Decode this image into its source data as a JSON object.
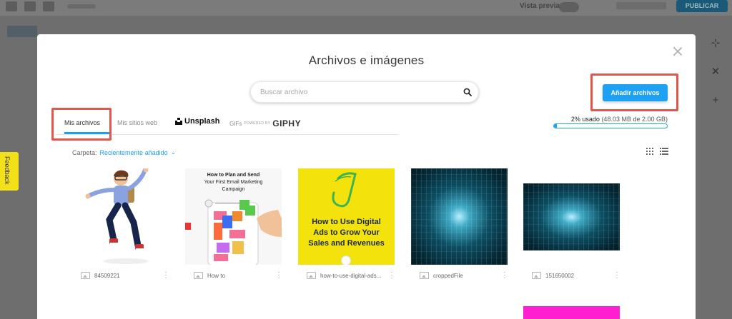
{
  "background": {
    "preview_label": "Vista previa",
    "publish_label": "PUBLICAR"
  },
  "feedback": {
    "label": "Feedback"
  },
  "modal": {
    "title": "Archivos e imágenes",
    "search": {
      "placeholder": "Buscar archivo",
      "value": ""
    },
    "add_button": "Añadir archivos",
    "tabs": [
      {
        "label": "Mis archivos",
        "active": true
      },
      {
        "label": "Mis sitios web",
        "active": false
      },
      {
        "label": "Unsplash",
        "active": false
      }
    ],
    "giphy": {
      "gifs": "GIFs",
      "powered": "POWERED BY",
      "brand": "GIPHY"
    },
    "storage": {
      "percent": "2% usado",
      "detail": "(48.03 MB de 2.00 GB)",
      "fraction": 0.024
    },
    "folder": {
      "label": "Carpeta:",
      "value": "Recientemente añadido"
    },
    "files": [
      {
        "name": "84509221"
      },
      {
        "name": "How to"
      },
      {
        "name": "how-to-use-digital-ads..."
      },
      {
        "name": "croppedFile"
      },
      {
        "name": "151650002"
      }
    ],
    "thumb_texts": {
      "email": {
        "line1": "How to Plan and Send",
        "line2": "Your First Email Marketing",
        "line3": "Campaign"
      },
      "ads": {
        "line1": "How to Use Digital",
        "line2": "Ads to Grow Your",
        "line3": "Sales and Revenues"
      }
    }
  },
  "colors": {
    "accent": "#1ea1f2",
    "highlight": "#e2574c",
    "yellow_card": "#f3e20c",
    "magenta_card": "#ff1fd1"
  }
}
